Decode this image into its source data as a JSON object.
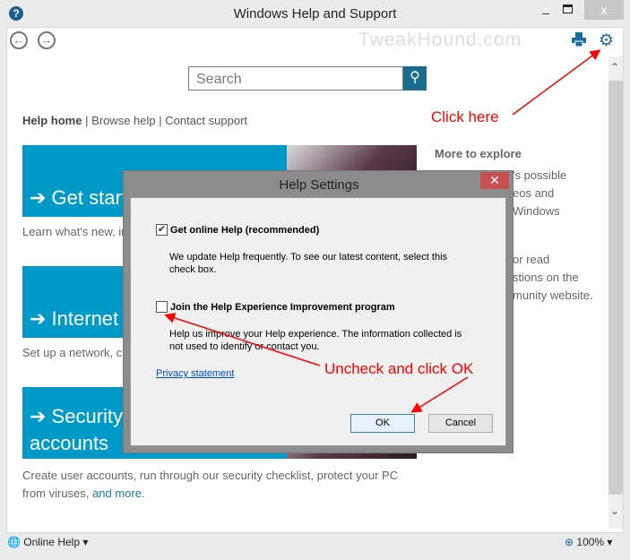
{
  "window": {
    "title": "Windows Help and Support",
    "minimize": "–",
    "close": "x",
    "help_icon": "?"
  },
  "toolbar": {
    "back": "←",
    "forward": "→",
    "watermark": "TweakHound.com",
    "print_icon": "print-icon",
    "settings_icon": "gear-icon",
    "gear_glyph": "⚙"
  },
  "search": {
    "placeholder": "Search",
    "button_glyph": "⚲"
  },
  "breadcrumb": {
    "home": "Help home",
    "sep": " | ",
    "browse": "Browse help",
    "contact": "Contact support"
  },
  "tiles": [
    {
      "title": "➔ Get start",
      "desc": "Learn what's new, in"
    },
    {
      "title": "➔ Internet",
      "desc": "Set up a network, c"
    },
    {
      "title": "➔ Security,",
      "title2": "accounts",
      "desc": "Create user accounts, run through our security checklist, protect your PC",
      "desc2": "from viruses, ",
      "link": "and more."
    }
  ],
  "more": {
    "title": "More to explore",
    "lines": [
      "'s possible",
      "eos and",
      "Windows",
      "or read",
      "stions on the",
      "munity website."
    ]
  },
  "status": {
    "online_help": "Online Help ▾",
    "zoom": "100% ▾"
  },
  "dialog": {
    "title": "Help Settings",
    "close": "✕",
    "option1": {
      "label": "Get online Help (recommended)",
      "checked": true,
      "desc": "We update Help frequently. To see our latest content, select this check box."
    },
    "option2": {
      "label": "Join the Help Experience Improvement program",
      "checked": false,
      "desc": "Help us improve your Help experience. The information collected is not used to identify or contact you."
    },
    "privacy": "Privacy statement",
    "ok": "OK",
    "cancel": "Cancel",
    "check_glyph": "✔"
  },
  "annotations": {
    "click_here": "Click here",
    "uncheck": "Uncheck and click OK",
    "color": "#ff0000"
  }
}
